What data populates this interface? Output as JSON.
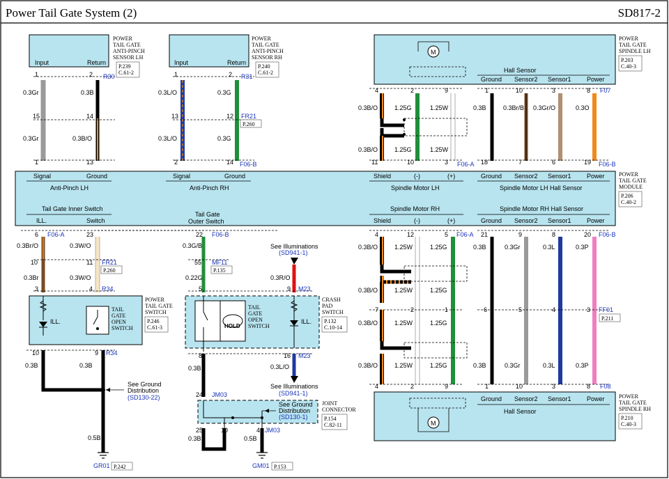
{
  "header": {
    "title": "Power Tail Gate System (2)",
    "code": "SD817-2"
  },
  "components": {
    "antipinch_lh": {
      "name": [
        "POWER",
        "TAIL GATE",
        "ANTI-PINCH",
        "SENSOR LH"
      ],
      "ref": [
        "P.239",
        "C.61-2"
      ],
      "pins": [
        "Input",
        "Return"
      ]
    },
    "antipinch_rh": {
      "name": [
        "POWER",
        "TAIL GATE",
        "ANTI-PINCH",
        "SENSOR RH"
      ],
      "ref": [
        "P.240",
        "C.61-2"
      ],
      "pins": [
        "Input",
        "Return"
      ]
    },
    "spindle_lh": {
      "name": [
        "POWER",
        "TAIL GATE",
        "SPINDLE LH"
      ],
      "ref": [
        "P.203",
        "C.40-3"
      ],
      "hall": "Hall Sensor",
      "pins": [
        "Ground",
        "Sensor2",
        "Sensor1",
        "Power"
      ]
    },
    "spindle_rh": {
      "name": [
        "POWER",
        "TAIL GATE",
        "SPINDLE RH"
      ],
      "ref": [
        "P.210",
        "C.40-3"
      ],
      "hall": "Hall Sensor",
      "pins": [
        "Ground",
        "Sensor2",
        "Sensor1",
        "Power"
      ]
    },
    "module": {
      "name": [
        "POWER",
        "TAIL GATE",
        "MODULE"
      ],
      "ref": [
        "P.206",
        "C.40-2"
      ],
      "top_groups": [
        {
          "label": "Anti-Pinch LH",
          "pins": [
            "Signal",
            "Ground"
          ]
        },
        {
          "label": "Anti-Pinch RH",
          "pins": [
            "Signal",
            "Ground"
          ]
        },
        {
          "label": "Spindle Motor LH",
          "pins": [
            "Shield",
            "(-)",
            "(+)"
          ]
        },
        {
          "label": "Spindle Motor LH Hall Sensor",
          "pins": [
            "Ground",
            "Sensor2",
            "Sensor1",
            "Power"
          ]
        }
      ],
      "bottom_groups": [
        {
          "label": "Tail Gate Inner Switch",
          "pins": [
            "ILL.",
            "Switch"
          ]
        },
        {
          "label": "Tail Gate\nOuter Switch",
          "pins": []
        },
        {
          "label": "Spindle Motor RH",
          "pins": [
            "Shield",
            "(-)",
            "(+)"
          ]
        },
        {
          "label": "Spindle Motor RH Hall Sensor",
          "pins": [
            "Ground",
            "Sensor2",
            "Sensor1",
            "Power"
          ]
        }
      ]
    },
    "tg_switch": {
      "name": [
        "POWER",
        "TAIL GATE",
        "SWITCH"
      ],
      "ref": [
        "P.246",
        "C.61-3"
      ],
      "inner": [
        "TAIL",
        "GATE",
        "OPEN",
        "SWITCH"
      ],
      "ill": "ILL."
    },
    "crash_pad": {
      "name": [
        "CRASH",
        "PAD",
        "SWITCH"
      ],
      "ref": [
        "P.132",
        "C.10-14"
      ],
      "inner": [
        "TAIL",
        "GATE",
        "OPEN",
        "SWITCH"
      ],
      "ill": "ILL.",
      "hold": "HOLD"
    },
    "joint": {
      "name": [
        "JOINT",
        "CONNECTOR"
      ],
      "ref": [
        "P.154",
        "C.82-11"
      ]
    }
  },
  "notes": {
    "see_illum_top": [
      "See Illuminations",
      "(SD941-1)"
    ],
    "see_illum_bottom": [
      "See Illuminations",
      "(SD941-1)"
    ],
    "see_ground_1": [
      "See Ground",
      "Distribution",
      "(SD130-22)"
    ],
    "see_ground_2": [
      "See Ground",
      "Distribution",
      "(SD130-1)"
    ]
  },
  "grounds": [
    {
      "id": "GR01",
      "ref": "P.242"
    },
    {
      "id": "GM01",
      "ref": "P.153"
    }
  ],
  "connectors": {
    "R30": "R30",
    "R31": "R31",
    "FR21_top": "FR21",
    "FR21_ref": "P.260",
    "F06B_1": "F06-B",
    "F06A_1": "F06-A",
    "F07": "F07",
    "F06B_2": "F06-B",
    "F06A_2": "F06-A",
    "FR21_b": "FR21",
    "FR21_bref": "P.260",
    "R34_a": "R34",
    "R34_b": "R34",
    "F06B_3": "F06-B",
    "MF11": "MF11",
    "MF11_ref": "P.135",
    "M23_a": "M23",
    "M23_b": "M23",
    "F06A_3": "F06-A",
    "F06B_4": "F06-B",
    "FF01": "FF01",
    "FF01_ref": "P.211",
    "F08": "F08",
    "JM03_a": "JM03",
    "JM03_b": "JM03"
  },
  "wires": {
    "ap_lh_input": [
      "0.3Gr",
      "0.3Gr"
    ],
    "ap_lh_return": [
      "0.3B",
      "0.3B/O"
    ],
    "ap_rh_input": [
      "0.3L/O",
      "0.3L/O"
    ],
    "ap_rh_return": [
      "0.3G",
      "0.3G"
    ],
    "sp_lh_shield": [
      "0.3B/O",
      "0.3B/O"
    ],
    "sp_lh_minus": [
      "1.25G",
      "1.25G"
    ],
    "sp_lh_plus": [
      "1.25W",
      "1.25W"
    ],
    "hall_lh": [
      "0.3B",
      "0.3Br/B",
      "0.3Gr/O",
      "0.3O"
    ],
    "inner_ill": [
      "0.3Br/O",
      "0.3Br"
    ],
    "inner_sw": [
      "0.3W/O",
      "0.3W/O"
    ],
    "outer": [
      "0.3G/B",
      "0.22G"
    ],
    "crash_ill": "0.3R/O",
    "crash_out": "0.3L/O",
    "tg_sw_out": [
      "0.3B",
      "0.3B"
    ],
    "gnd_lh": "0.5B",
    "outer_gnd": "0.3B",
    "joint_out": [
      "0.3B",
      "0.5B"
    ],
    "sp_rh_shield": [
      "0.3B/O",
      "0.3B/O"
    ],
    "sp_rh_minus": [
      "1.25W",
      "1.25W",
      "1.25W"
    ],
    "sp_rh_plus": [
      "1.25G",
      "1.25G",
      "1.25G"
    ],
    "hall_rh": [
      "0.3B",
      "0.3Gr",
      "0.3L",
      "0.3P"
    ]
  },
  "colors": {
    "gray": "#9a9a9a",
    "black": "#000000",
    "orange": "#f08a1c",
    "blue": "#1f3a9e",
    "green": "#1f8f3a",
    "brown": "#7a4a22",
    "tan": "#b09070",
    "red": "#e01010",
    "pink": "#ef7fc0",
    "white": "#ffffff",
    "panel": "#b8e4ef"
  }
}
